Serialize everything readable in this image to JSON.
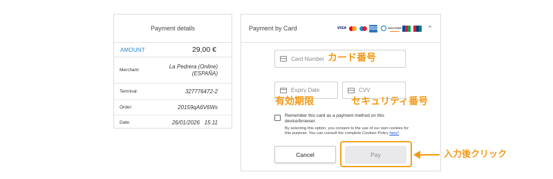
{
  "details": {
    "title": "Payment details",
    "amount_label": "AMOUNT",
    "amount_value": "29,00  €",
    "rows": [
      {
        "label": "Merchant:",
        "value": "La Pedrera (Online) (ESPAÑA)"
      },
      {
        "label": "Terminal:",
        "value": "327776472-2"
      },
      {
        "label": "Order:",
        "value": "20159qA6V6Ws"
      },
      {
        "label": "Date:",
        "value": "26/01/2026   15:11"
      }
    ]
  },
  "card": {
    "title": "Payment by Card",
    "logos": [
      "VISA",
      "Mastercard",
      "Maestro",
      "AMEX",
      "Diners Club",
      "DISCOVER",
      "JCB",
      "UnionPay"
    ],
    "logo_text": {
      "visa": "VISA",
      "amex": "AMERICAN EXPRESS",
      "discover": "DISCOVER"
    },
    "collapse_icon": "chevron-up-icon",
    "card_number_placeholder": "Card Number",
    "expiry_placeholder": "Expiry Date",
    "cvv_placeholder": "CVV",
    "remember_label": "Remember this card as a payment method on this device/browser.",
    "consent_text": "By selecting this option, you consent to the use of our own cookies for this purpose. You can consult the complete Cookies Policy ",
    "consent_link": "here*",
    "consent_end": ".",
    "cancel_label": "Cancel",
    "pay_label": "Pay"
  },
  "annotations": {
    "card_number": "カード番号",
    "expiry": "有効期限",
    "cvv": "セキュリティ番号",
    "click": "入力後クリック",
    "color": "#f29a17"
  }
}
